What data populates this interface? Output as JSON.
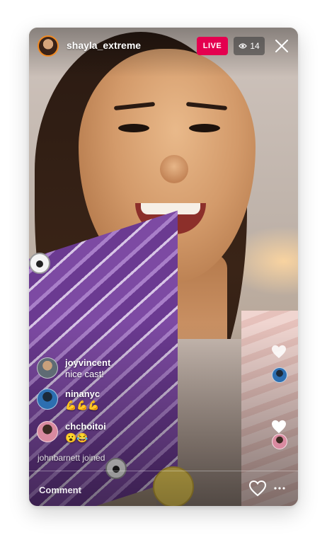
{
  "header": {
    "username": "shayla_extreme",
    "live_label": "LIVE",
    "viewer_count": "14"
  },
  "comments": [
    {
      "user": "joyvincent",
      "message": "nice cast!",
      "avatar_color": "#5f6b74"
    },
    {
      "user": "ninanyc",
      "message": "💪💪💪",
      "avatar_color": "#2d6fb1"
    },
    {
      "user": "chchoitoi",
      "message": "😮😂",
      "avatar_color": "#d98aa0"
    }
  ],
  "joined_notice": "johnbarnett joined",
  "comment_bar": {
    "placeholder": "Comment"
  },
  "colors": {
    "live_badge": "#e4004f",
    "avatar_ring": "#f08a24",
    "text": "#ffffff"
  },
  "icons": {
    "viewer": "eye-icon",
    "close": "close-icon",
    "like": "heart-outline-icon",
    "more": "more-horizontal-icon"
  }
}
